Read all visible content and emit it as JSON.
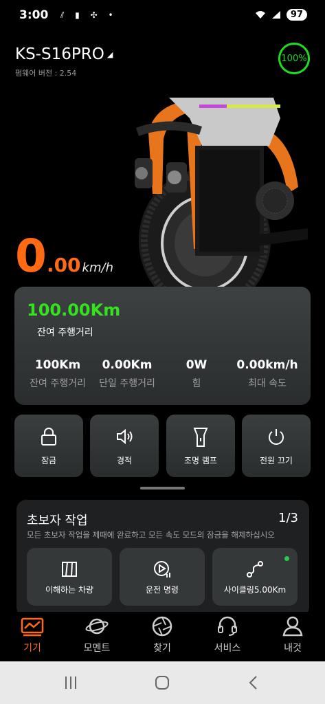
{
  "status_bar": {
    "time": "3:00",
    "battery": "97"
  },
  "device": {
    "name": "KS-S16PRO",
    "firmware": "펌웨어 버전 : 2.54",
    "battery_level": "100%"
  },
  "speed": {
    "integer": "0",
    "decimal": ".00",
    "unit": "km/h"
  },
  "stats": {
    "remaining_value": "100.00Km",
    "remaining_label": "잔여 주행거리",
    "items": [
      {
        "value": "100Km",
        "label": "잔여 주행거리"
      },
      {
        "value": "0.00Km",
        "label": "단일 주행거리"
      },
      {
        "value": "0W",
        "label": "힘"
      },
      {
        "value": "0.00km/h",
        "label": "최대 속도"
      }
    ]
  },
  "quick_actions": [
    {
      "label": "잠금",
      "icon": "lock-icon"
    },
    {
      "label": "경적",
      "icon": "horn-icon"
    },
    {
      "label": "조명 램프",
      "icon": "flashlight-icon"
    },
    {
      "label": "전원 끄기",
      "icon": "power-icon"
    }
  ],
  "tasks": {
    "title": "초보자 작업",
    "progress": "1/3",
    "description": "모든 초보자 작업을 제때에 완료하고 모든 속도 모드의 잠금을 해제하십시오",
    "cards": [
      {
        "label": "이해하는 차량",
        "icon": "vehicle-icon"
      },
      {
        "label": "운전 명령",
        "icon": "play-icon"
      },
      {
        "label": "사이클링5.00Km",
        "icon": "route-icon"
      }
    ]
  },
  "nav": [
    {
      "label": "기기",
      "icon": "device-icon"
    },
    {
      "label": "모멘트",
      "icon": "planet-icon"
    },
    {
      "label": "찾기",
      "icon": "aperture-icon"
    },
    {
      "label": "서비스",
      "icon": "headset-icon"
    },
    {
      "label": "내것",
      "icon": "profile-icon"
    }
  ],
  "colors": {
    "accent": "#ff6a13",
    "battery_green": "#1ddb1d",
    "distance_green": "#35e21e",
    "card_bg": "#2f3233"
  }
}
